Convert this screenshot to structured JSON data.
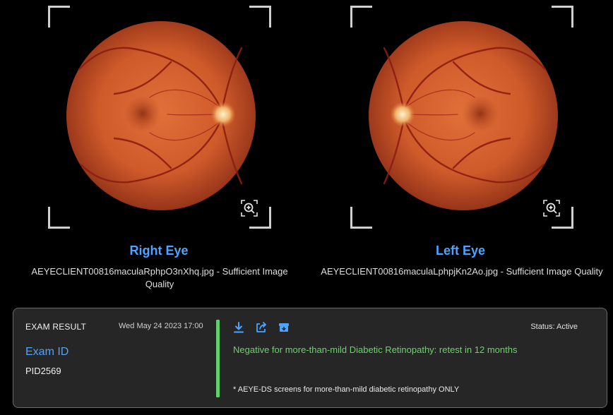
{
  "eyes": {
    "right": {
      "title": "Right Eye",
      "file": "AEYECLIENT00816maculaRphpO3nXhq.jpg - Sufficient Image Quality"
    },
    "left": {
      "title": "Left Eye",
      "file": "AEYECLIENT00816maculaLphpjKn2Ao.jpg - Sufficient Image Quality"
    }
  },
  "icons": {
    "zoom": "zoom-in-icon",
    "download": "download-icon",
    "share": "share-icon",
    "archive": "archive-icon"
  },
  "exam": {
    "label": "EXAM RESULT",
    "date": "Wed May 24 2023 17:00",
    "id_label": "Exam ID",
    "id_value": "PID2569",
    "status": "Status: Active",
    "result": "Negative for more-than-mild Diabetic Retinopathy: retest in 12 months",
    "footnote": "* AEYE-DS screens for more-than-mild diabetic retinopathy ONLY"
  },
  "colors": {
    "accent_blue": "#4da3ff",
    "result_green": "#6ad46a",
    "bar_green": "#5fd06a",
    "card_bg": "#262626"
  }
}
